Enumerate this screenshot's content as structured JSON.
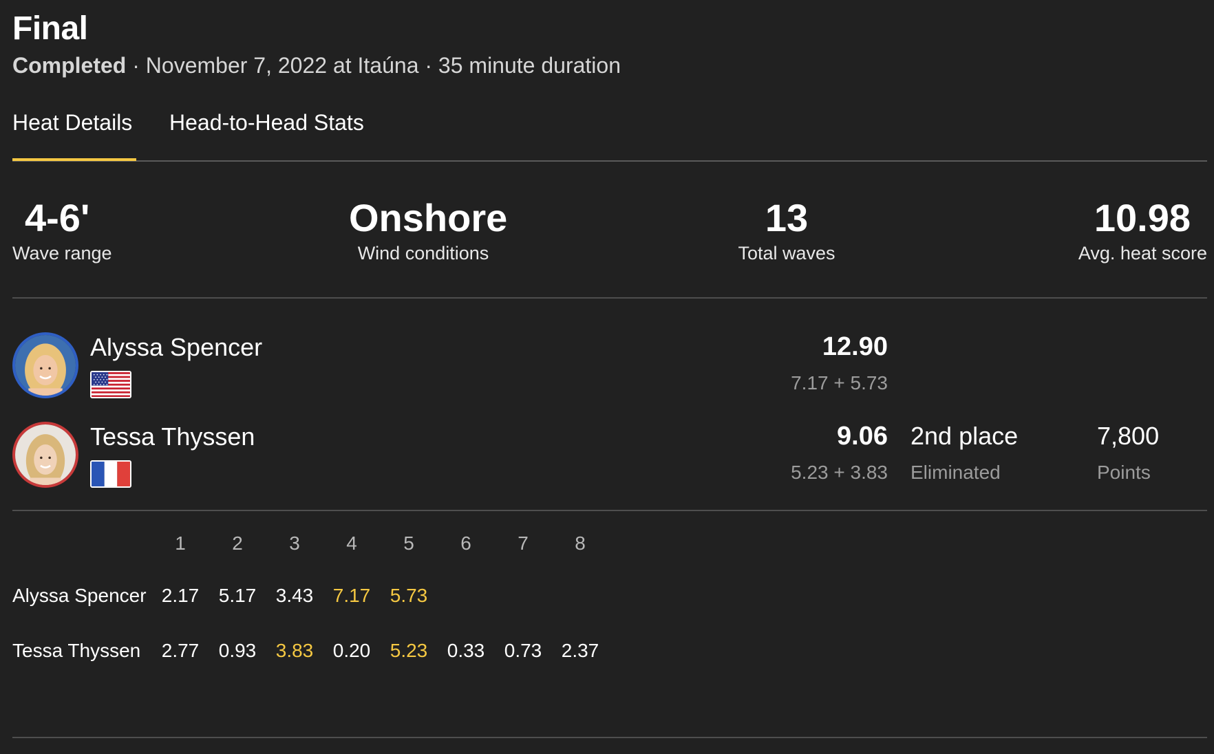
{
  "header": {
    "title": "Final",
    "status": "Completed",
    "separator": " · ",
    "details": "November 7, 2022 at Itaúna · 35 minute duration"
  },
  "tabs": [
    {
      "label": "Heat Details",
      "active": true
    },
    {
      "label": "Head-to-Head Stats",
      "active": false
    }
  ],
  "colors": {
    "background": "#212121",
    "accent": "#f5c842",
    "athlete1_ring": "#2f5fc4",
    "athlete2_ring": "#c83a3a"
  },
  "stats": [
    {
      "value": "4-6'",
      "label": "Wave range"
    },
    {
      "value": "Onshore",
      "label": "Wind conditions"
    },
    {
      "value": "13",
      "label": "Total waves"
    },
    {
      "value": "10.98",
      "label": "Avg. heat score"
    }
  ],
  "athletes": [
    {
      "name": "Alyssa Spencer",
      "country_flag": "usa-flag-icon",
      "total": "12.90",
      "breakdown": "7.17 + 5.73",
      "place": "",
      "place_sub": "",
      "points": "",
      "points_sub": ""
    },
    {
      "name": "Tessa Thyssen",
      "country_flag": "france-flag-icon",
      "total": "9.06",
      "breakdown": "5.23 + 3.83",
      "place": "2nd place",
      "place_sub": "Eliminated",
      "points": "7,800",
      "points_sub": "Points"
    }
  ],
  "wave_table": {
    "headers": [
      "1",
      "2",
      "3",
      "4",
      "5",
      "6",
      "7",
      "8"
    ],
    "rows": [
      {
        "name": "Alyssa Spencer",
        "scores": [
          "2.17",
          "5.17",
          "3.43",
          "7.17",
          "5.73",
          "",
          "",
          ""
        ],
        "counting": [
          false,
          false,
          false,
          true,
          true,
          false,
          false,
          false
        ]
      },
      {
        "name": "Tessa Thyssen",
        "scores": [
          "2.77",
          "0.93",
          "3.83",
          "0.20",
          "5.23",
          "0.33",
          "0.73",
          "2.37"
        ],
        "counting": [
          false,
          false,
          true,
          false,
          true,
          false,
          false,
          false
        ]
      }
    ]
  }
}
